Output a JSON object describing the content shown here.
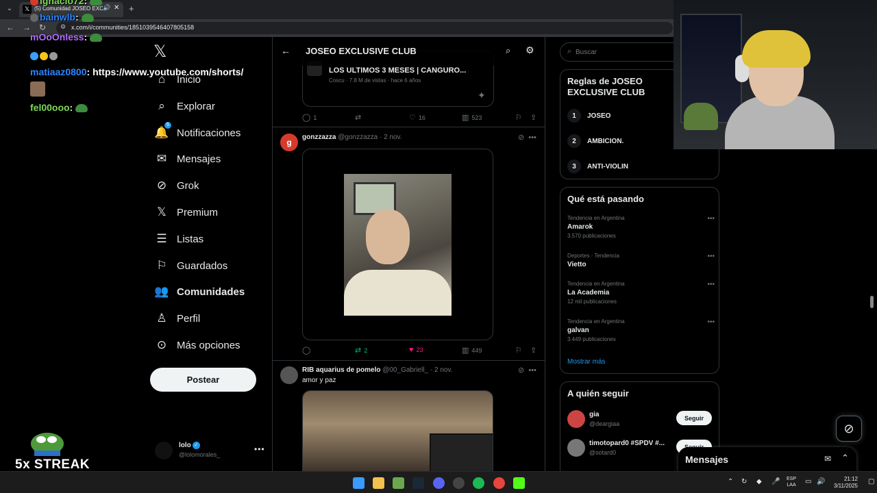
{
  "browser": {
    "tab_title": "(5) Comunidad JOSEO EXCL",
    "url": "x.com/i/communities/1851039546407805158"
  },
  "chat": [
    {
      "user": "ignacio72",
      "color": "#7ed957",
      "message": ""
    },
    {
      "user": "bainwlb",
      "color": "#2b86ff",
      "message": ""
    },
    {
      "user": "mOoOnless",
      "color": "#b56cff",
      "message": ""
    },
    {
      "user": "matiaaz0800",
      "color": "#2b86ff",
      "message": ": https://www.youtube.com/shorts/"
    },
    {
      "user": "fel00ooo",
      "color": "#7ed957",
      "message": ""
    }
  ],
  "streak": "5x STREAK",
  "nav": {
    "items": [
      {
        "label": "Inicio",
        "icon": "home-icon"
      },
      {
        "label": "Explorar",
        "icon": "search-icon"
      },
      {
        "label": "Notificaciones",
        "icon": "bell-icon",
        "badge": "5"
      },
      {
        "label": "Mensajes",
        "icon": "mail-icon"
      },
      {
        "label": "Grok",
        "icon": "grok-icon"
      },
      {
        "label": "Premium",
        "icon": "x-icon"
      },
      {
        "label": "Listas",
        "icon": "list-icon"
      },
      {
        "label": "Guardados",
        "icon": "bookmark-icon"
      },
      {
        "label": "Comunidades",
        "icon": "communities-icon",
        "active": true
      },
      {
        "label": "Perfil",
        "icon": "person-icon"
      },
      {
        "label": "Más opciones",
        "icon": "more-icon"
      }
    ],
    "post_button": "Postear"
  },
  "account": {
    "name": "lolo",
    "handle": "@lolomorales_"
  },
  "community": {
    "title": "JOSEO EXCLUSIVE CLUB"
  },
  "posts": [
    {
      "card_title": "LOS ULTIMOS 3 MESES | CANGURO...",
      "card_meta": "Coscu · 7.8 M de vistas · hace 6 años",
      "replies": "1",
      "reposts": "",
      "likes": "16",
      "views": "523"
    },
    {
      "avatar_letter": "g",
      "avatar_color": "#d63a2b",
      "name": "gonzzazza",
      "handle": "@gonzzazza",
      "date": "· 2 nov.",
      "replies": "",
      "reposts": "2",
      "likes": "23",
      "views": "449"
    },
    {
      "name": "RIB aquarius de pomelo",
      "handle": "@00_Gabriell_",
      "date": "· 2 nov.",
      "text": "amor y paz"
    }
  ],
  "sidebar": {
    "search_placeholder": "Buscar",
    "rules_title": "Reglas de JOSEO EXCLUSIVE CLUB",
    "rules": [
      {
        "num": "1",
        "text": "JOSEO"
      },
      {
        "num": "2",
        "text": "AMBICION."
      },
      {
        "num": "3",
        "text": "ANTI-VIOLIN"
      }
    ],
    "trends_title": "Qué está pasando",
    "trends": [
      {
        "context": "Tendencia en Argentina",
        "topic": "Amarok",
        "count": "3.570 publicaciones"
      },
      {
        "context": "Deportes · Tendencia",
        "topic": "Vietto",
        "count": ""
      },
      {
        "context": "Tendencia en Argentina",
        "topic": "La Academia",
        "count": "12 mil publicaciones"
      },
      {
        "context": "Tendencia en Argentina",
        "topic": "galvan",
        "count": "3.449 publicaciones"
      }
    ],
    "show_more": "Mostrar más",
    "follow_title": "A quién seguir",
    "follow": [
      {
        "name": "gia",
        "handle": "@deargiaa",
        "button": "Seguir"
      },
      {
        "name": "timotopard0 #SPDV #...",
        "handle": "@sotard0",
        "button": "Seguir"
      }
    ]
  },
  "messages_drawer": "Mensajes",
  "taskbar": {
    "lang_top": "ESP",
    "lang_bottom": "LAA",
    "time": "21:12",
    "date": "3/11/2025"
  }
}
